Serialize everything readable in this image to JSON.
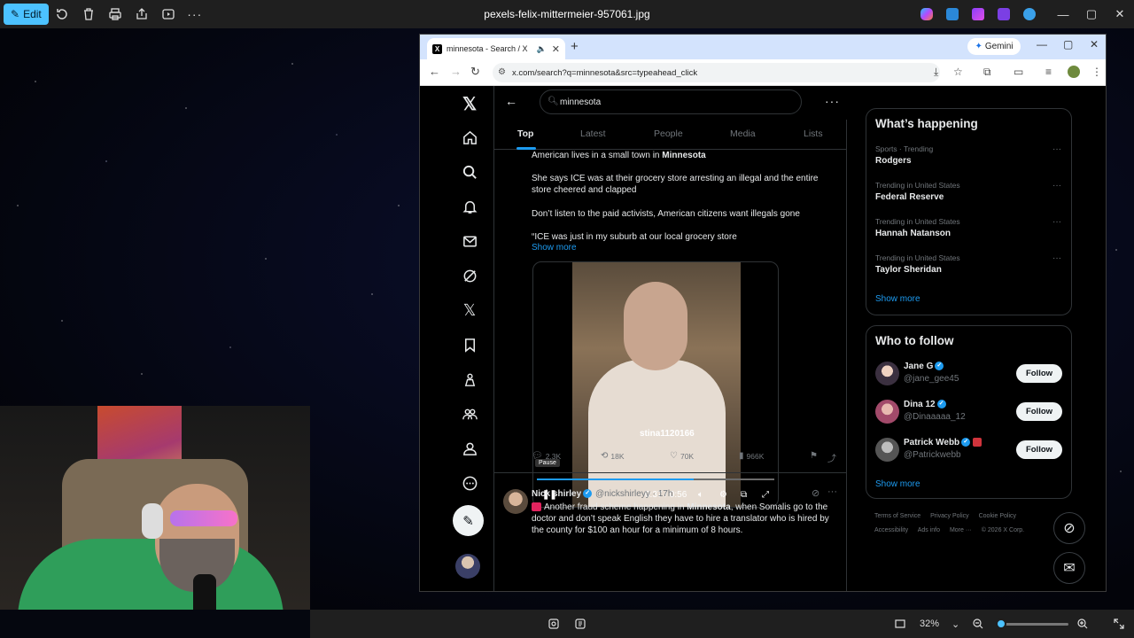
{
  "viewer": {
    "edit_label": "Edit",
    "file_title": "pexels-felix-mittermeier-957061.jpg",
    "zoom": "32%",
    "zoom_level": 0.05
  },
  "browser": {
    "tab_title": "minnesota - Search / X",
    "gemini_label": "Gemini",
    "url": "x.com/search?q=minnesota&src=typeahead_click"
  },
  "search": {
    "query": "minnesota",
    "tabs": [
      "Top",
      "Latest",
      "People",
      "Media",
      "Lists"
    ],
    "active_tab": "Top"
  },
  "tweet": {
    "line1_pre": "American lives in a small town in ",
    "line1_bold": "Minnesota",
    "para2": "She says ICE was at their grocery store arresting an illegal and the entire store cheered and clapped",
    "para3": "Don’t listen to the paid activists, American citizens want illegals gone",
    "para4": "“ICE was just in my suburb at our local grocery store",
    "show_more": "Show more",
    "video": {
      "caption": "stina1120166",
      "tooltip": "Pause",
      "time": "0:37 / 0:56",
      "progress": 0.66
    },
    "stats": {
      "replies": "2.3K",
      "reposts": "18K",
      "likes": "70K",
      "views": "966K"
    }
  },
  "tweet2": {
    "name": "Nick shirley",
    "handle": "@nickshirleyy · 17h",
    "text_pre": "Another fraud scheme happening in ",
    "text_bold": "Minnesota",
    "text_post": ", when Somalis go to the doctor and don’t speak English they have to hire a translator who is hired by the county for $100 an hour for a minimum of 8 hours."
  },
  "happening": {
    "title": "What’s happening",
    "trends": [
      {
        "meta": "Sports · Trending",
        "name": "Rodgers"
      },
      {
        "meta": "Trending in United States",
        "name": "Federal Reserve"
      },
      {
        "meta": "Trending in United States",
        "name": "Hannah Natanson"
      },
      {
        "meta": "Trending in United States",
        "name": "Taylor Sheridan"
      }
    ],
    "show_more": "Show more"
  },
  "who_to_follow": {
    "title": "Who to follow",
    "users": [
      {
        "name": "Jane G",
        "handle": "@jane_gee45",
        "button": "Follow"
      },
      {
        "name": "Dina 12",
        "handle": "@Dinaaaaa_12",
        "button": "Follow"
      },
      {
        "name": "Patrick Webb",
        "handle": "@Patrickwebb",
        "button": "Follow"
      }
    ],
    "show_more": "Show more"
  },
  "footer": {
    "links": [
      "Terms of Service",
      "Privacy Policy",
      "Cookie Policy",
      "Accessibility",
      "Ads info",
      "More ···",
      "© 2026 X Corp."
    ]
  },
  "colors": {
    "accent": "#1d9bf0",
    "viewer_accent": "#4cc2ff"
  }
}
